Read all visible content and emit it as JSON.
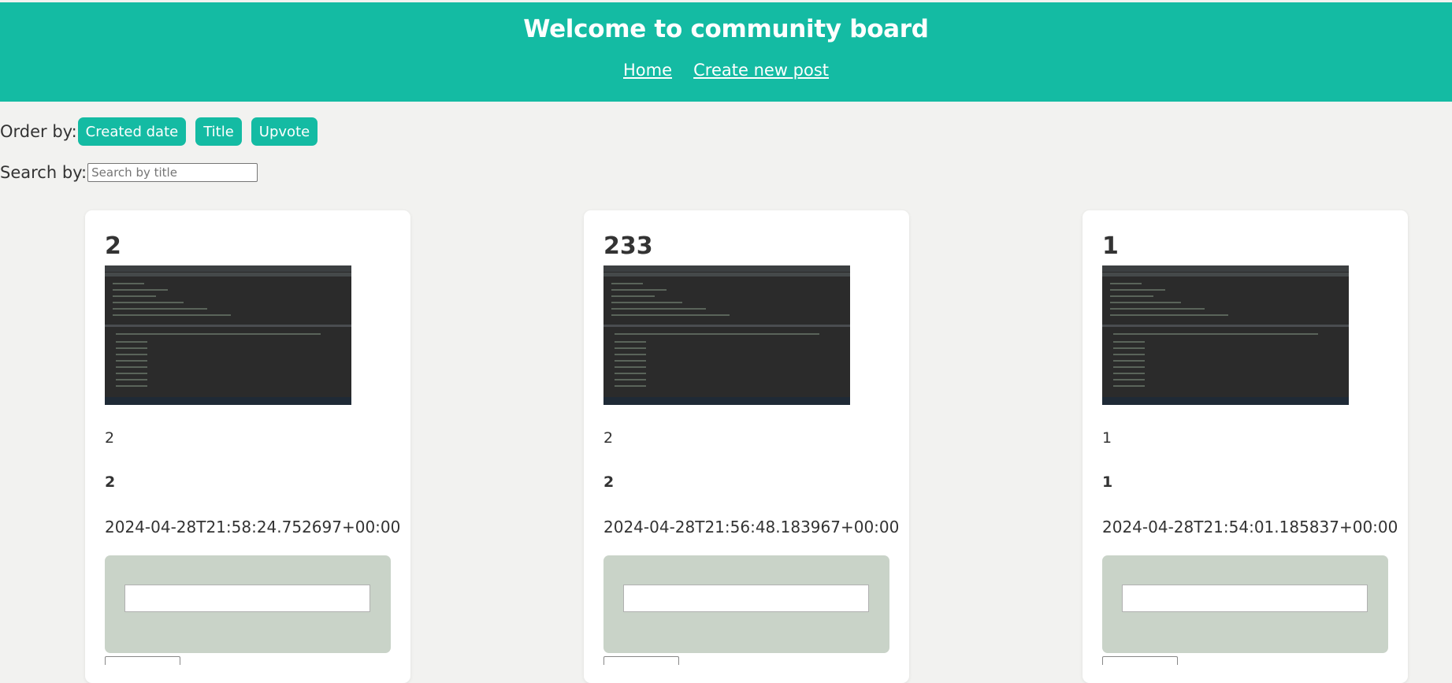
{
  "header": {
    "title": "Welcome to community board",
    "nav": {
      "home": "Home",
      "create": "Create new post"
    },
    "bg_color": "#14bba3"
  },
  "order": {
    "label": "Order by:",
    "buttons": [
      "Created date",
      "Title",
      "Upvote"
    ]
  },
  "search": {
    "label": "Search by:",
    "placeholder": "Search by title"
  },
  "posts": [
    {
      "title": "2",
      "description": "2",
      "upvotes": "2",
      "created_at": "2024-04-28T21:58:24.752697+00:00"
    },
    {
      "title": "233",
      "description": "2",
      "upvotes": "2",
      "created_at": "2024-04-28T21:56:48.183967+00:00"
    },
    {
      "title": "1",
      "description": "1",
      "upvotes": "1",
      "created_at": "2024-04-28T21:54:01.185837+00:00"
    }
  ]
}
